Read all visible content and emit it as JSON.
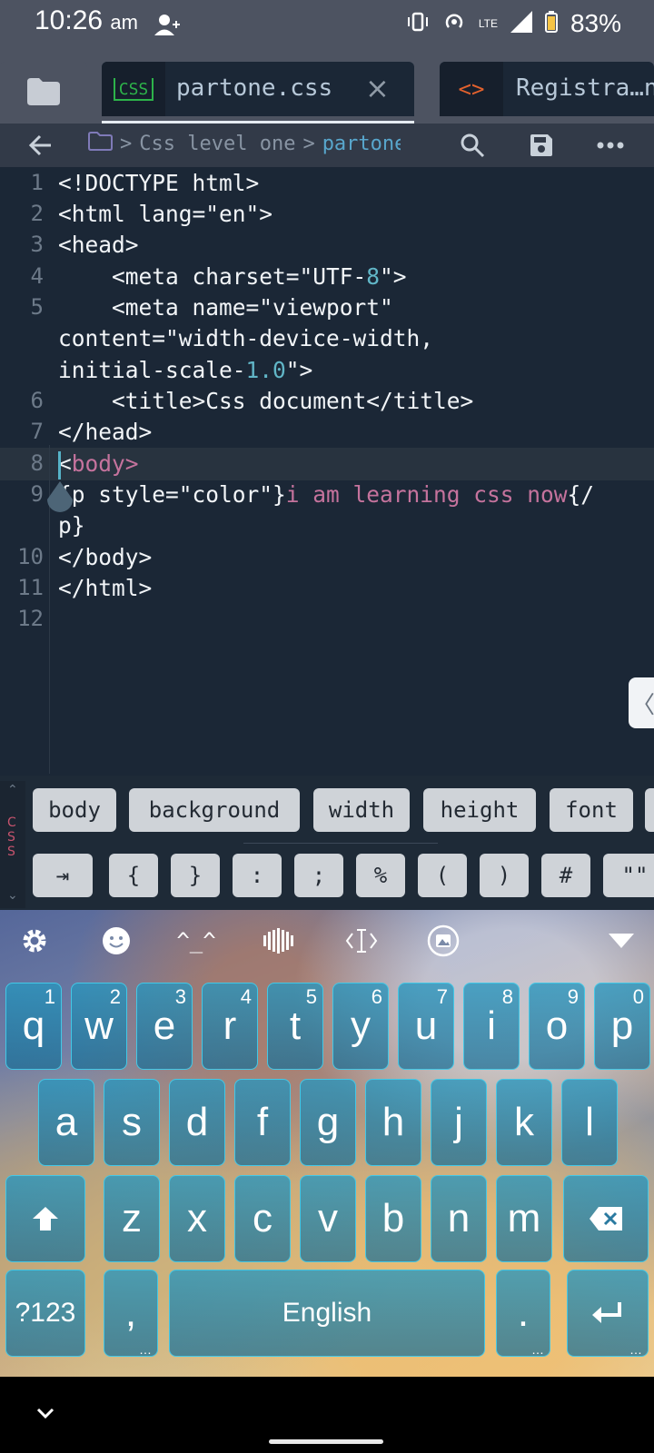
{
  "status_bar": {
    "time": "10:26",
    "ampm": "am",
    "network": "LTE",
    "battery": "83%"
  },
  "tabs": [
    {
      "icon_label": "CSS",
      "label": "partone.css",
      "close": "×"
    },
    {
      "icon_label": "<>",
      "label": "Registra…n"
    }
  ],
  "breadcrumb": {
    "sep": ">",
    "folder": "Css level one",
    "current": "partone"
  },
  "editor": {
    "line_numbers": [
      "1",
      "2",
      "3",
      "4",
      "5",
      "6",
      "7",
      "8",
      "9",
      "10",
      "11",
      "12"
    ]
  },
  "suggestions": [
    "body",
    "background",
    "width",
    "height",
    "font"
  ],
  "symbols": [
    "⇥",
    "{",
    "}",
    ":",
    ";",
    "%",
    "(",
    ")",
    "#",
    "\"\""
  ],
  "css_side_label": "CSS",
  "side_tab_glyph": "〈",
  "keyboard": {
    "row1": [
      [
        "q",
        "1"
      ],
      [
        "w",
        "2"
      ],
      [
        "e",
        "3"
      ],
      [
        "r",
        "4"
      ],
      [
        "t",
        "5"
      ],
      [
        "y",
        "6"
      ],
      [
        "u",
        "7"
      ],
      [
        "i",
        "8"
      ],
      [
        "o",
        "9"
      ],
      [
        "p",
        "0"
      ]
    ],
    "row2": [
      "a",
      "s",
      "d",
      "f",
      "g",
      "h",
      "j",
      "k",
      "l"
    ],
    "row3": [
      "z",
      "x",
      "c",
      "v",
      "b",
      "n",
      "m"
    ],
    "symbols_key": "?123",
    "comma_key": ",",
    "space_label": "English",
    "period_key": ".",
    "more_dots": "…",
    "toolbar_icons": [
      "settings-icon",
      "emoji-icon",
      "kaomoji-icon",
      "voice-icon",
      "cursor-icon",
      "sticker-icon",
      "collapse-icon"
    ],
    "kaomoji": "^_^"
  },
  "colors": {
    "editor_bg": "#1b2736",
    "key_border": "#43c8e6",
    "accent": "#56b3c8",
    "tag_pink": "#c5739d"
  }
}
